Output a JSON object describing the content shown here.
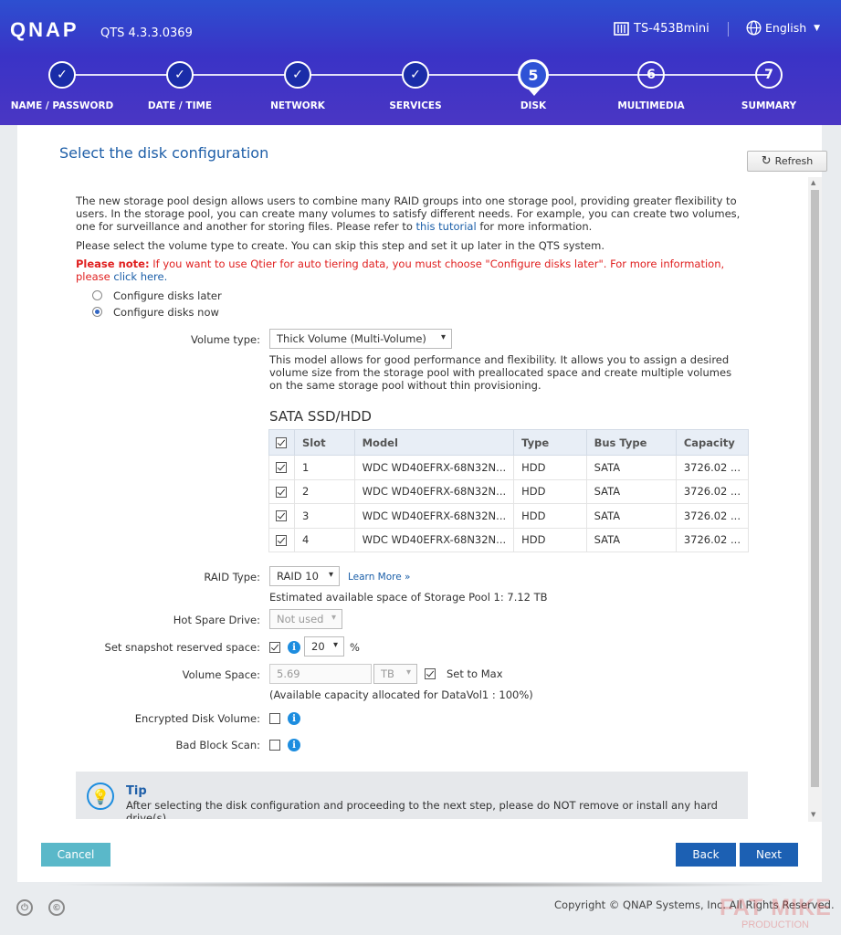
{
  "header": {
    "logo": "QNAP",
    "version": "QTS 4.3.3.0369",
    "device_model": "TS-453Bmini",
    "language": "English"
  },
  "wizard_steps": [
    {
      "number": "1",
      "label": "NAME / PASSWORD",
      "status": "done"
    },
    {
      "number": "2",
      "label": "DATE / TIME",
      "status": "done"
    },
    {
      "number": "3",
      "label": "NETWORK",
      "status": "done"
    },
    {
      "number": "4",
      "label": "SERVICES",
      "status": "done"
    },
    {
      "number": "5",
      "label": "DISK",
      "status": "current"
    },
    {
      "number": "6",
      "label": "MULTIMEDIA",
      "status": "todo"
    },
    {
      "number": "7",
      "label": "SUMMARY",
      "status": "todo"
    }
  ],
  "panel": {
    "title": "Select the disk configuration",
    "refresh_label": "Refresh",
    "intro_text": "The new storage pool design allows users to combine many RAID groups into one storage pool, providing greater flexibility to users. In the storage pool, you can create many volumes to satisfy different needs. For example, you can create two volumes, one for surveillance and another for storing files. Please refer to",
    "intro_link": "this tutorial",
    "intro_tail": "for more information.",
    "select_text": "Please select the volume type to create. You can skip this step and set it up later in the QTS system.",
    "note_label": "Please note:",
    "note_text": "If you want to use Qtier for auto tiering data, you must choose \"Configure disks later\". For more information, please",
    "note_link": "click here.",
    "options": [
      {
        "label": "Configure disks later",
        "selected": false
      },
      {
        "label": "Configure disks now",
        "selected": true
      }
    ],
    "volume_type_label": "Volume type:",
    "volume_type_value": "Thick Volume (Multi-Volume)",
    "volume_desc": "This model allows for good performance and flexibility. It allows you to assign a desired volume size from the storage pool with preallocated space and create multiple volumes on the same storage pool without thin provisioning.",
    "disk_section_title": "SATA SSD/HDD",
    "disk_table": {
      "columns": [
        "Slot",
        "Model",
        "Type",
        "Bus Type",
        "Capacity"
      ],
      "rows": [
        [
          "1",
          "WDC WD40EFRX-68N32N...",
          "HDD",
          "SATA",
          "3726.02 ..."
        ],
        [
          "2",
          "WDC WD40EFRX-68N32N...",
          "HDD",
          "SATA",
          "3726.02 ..."
        ],
        [
          "3",
          "WDC WD40EFRX-68N32N...",
          "HDD",
          "SATA",
          "3726.02 ..."
        ],
        [
          "4",
          "WDC WD40EFRX-68N32N...",
          "HDD",
          "SATA",
          "3726.02 ..."
        ]
      ]
    },
    "raid_type_label": "RAID Type:",
    "raid_type_value": "RAID 10",
    "learn_more": "Learn More »",
    "estimated_space": "Estimated available space of Storage Pool 1: 7.12 TB",
    "hot_spare_label": "Hot Spare Drive:",
    "hot_spare_value": "Not used",
    "snapshot_label": "Set snapshot reserved space:",
    "snapshot_value": "20",
    "snapshot_unit": "%",
    "volume_space_label": "Volume Space:",
    "volume_space_value": "5.69",
    "volume_space_unit": "TB",
    "set_to_max": "Set to Max",
    "available_capacity": "(Available capacity allocated for DataVol1 : 100%)",
    "encrypted_label": "Encrypted Disk Volume:",
    "bad_block_label": "Bad Block Scan:",
    "tip_title": "Tip",
    "tip_text": "After selecting the disk configuration and proceeding to the next step, please do NOT remove or install any hard drive(s).",
    "cancel_label": "Cancel",
    "back_label": "Back",
    "next_label": "Next"
  },
  "footer": {
    "copyright": "Copyright © QNAP Systems, Inc. All Rights Reserved.",
    "watermark_main": "FAT MIKE",
    "watermark_sub": "PRODUCTION"
  },
  "colors": {
    "header_gradient_top": "#2d4fd0",
    "header_gradient_bottom": "#4a36c4",
    "title_blue": "#1f5fa8",
    "button_blue": "#1c60b3",
    "cancel_teal": "#5ab8c9",
    "note_red": "#e02020",
    "info_blue": "#1d8ddf"
  }
}
